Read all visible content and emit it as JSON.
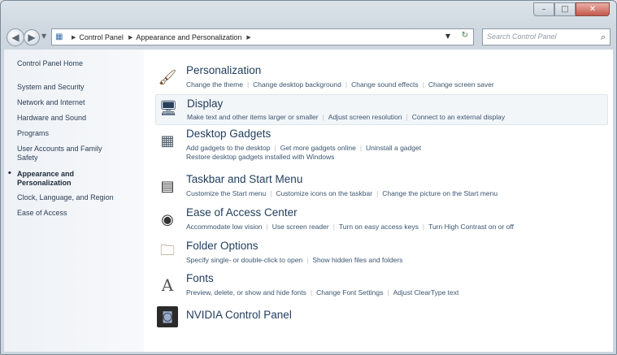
{
  "window": {
    "controls": {
      "minimize": "–",
      "maximize": "□",
      "close": "✕"
    }
  },
  "navbar": {
    "back_glyph": "◀",
    "forward_glyph": "▶",
    "history_glyph": "▼",
    "breadcrumb": [
      "Control Panel",
      "Appearance and Personalization"
    ],
    "crumb_separator": "▶",
    "dropdown_glyph": "▼",
    "refresh_glyph": "↻",
    "search_placeholder": "Search Control Panel",
    "search_glyph": "⌕"
  },
  "sidebar": {
    "items": [
      {
        "label": "Control Panel Home"
      },
      {
        "label": "System and Security"
      },
      {
        "label": "Network and Internet"
      },
      {
        "label": "Hardware and Sound"
      },
      {
        "label": "Programs"
      },
      {
        "label": "User Accounts and Family Safety"
      },
      {
        "label": "Appearance and Personalization",
        "current": true
      },
      {
        "label": "Clock, Language, and Region"
      },
      {
        "label": "Ease of Access"
      }
    ],
    "bullet": "•"
  },
  "categories": [
    {
      "title": "Personalization",
      "icon": "personalization-icon",
      "links": [
        "Change the theme",
        "Change desktop background",
        "Change sound effects",
        "Change screen saver"
      ],
      "links2": []
    },
    {
      "title": "Display",
      "icon": "display-icon",
      "links": [
        "Make text and other items larger or smaller",
        "Adjust screen resolution",
        "Connect to an external display"
      ],
      "links2": []
    },
    {
      "title": "Desktop Gadgets",
      "icon": "gadgets-icon",
      "links": [
        "Add gadgets to the desktop",
        "Get more gadgets online",
        "Uninstall a gadget"
      ],
      "links2": [
        "Restore desktop gadgets installed with Windows"
      ]
    },
    {
      "title": "Taskbar and Start Menu",
      "icon": "taskbar-icon",
      "links": [
        "Customize the Start menu",
        "Customize icons on the taskbar",
        "Change the picture on the Start menu"
      ],
      "links2": []
    },
    {
      "title": "Ease of Access Center",
      "icon": "ease-of-access-icon",
      "links": [
        "Accommodate low vision",
        "Use screen reader",
        "Turn on easy access keys",
        "Turn High Contrast on or off"
      ],
      "links2": []
    },
    {
      "title": "Folder Options",
      "icon": "folder-options-icon",
      "links": [
        "Specify single- or double-click to open",
        "Show hidden files and folders"
      ],
      "links2": []
    },
    {
      "title": "Fonts",
      "icon": "fonts-icon",
      "links": [
        "Preview, delete, or show and hide fonts",
        "Change Font Settings",
        "Adjust ClearType text"
      ],
      "links2": []
    },
    {
      "title": "NVIDIA Control Panel",
      "icon": "nvidia-icon",
      "links": [],
      "links2": []
    }
  ],
  "icon_glyphs": {
    "personalization-icon": "🖌",
    "display-icon": "🖥",
    "gadgets-icon": "▦",
    "taskbar-icon": "▤",
    "ease-of-access-icon": "◉",
    "folder-options-icon": "🗀",
    "fonts-icon": "A",
    "nvidia-icon": "◙"
  },
  "colors": {
    "link": "#3b5570",
    "title": "#1f3c5c",
    "sidebar_link": "#2b3e55"
  }
}
